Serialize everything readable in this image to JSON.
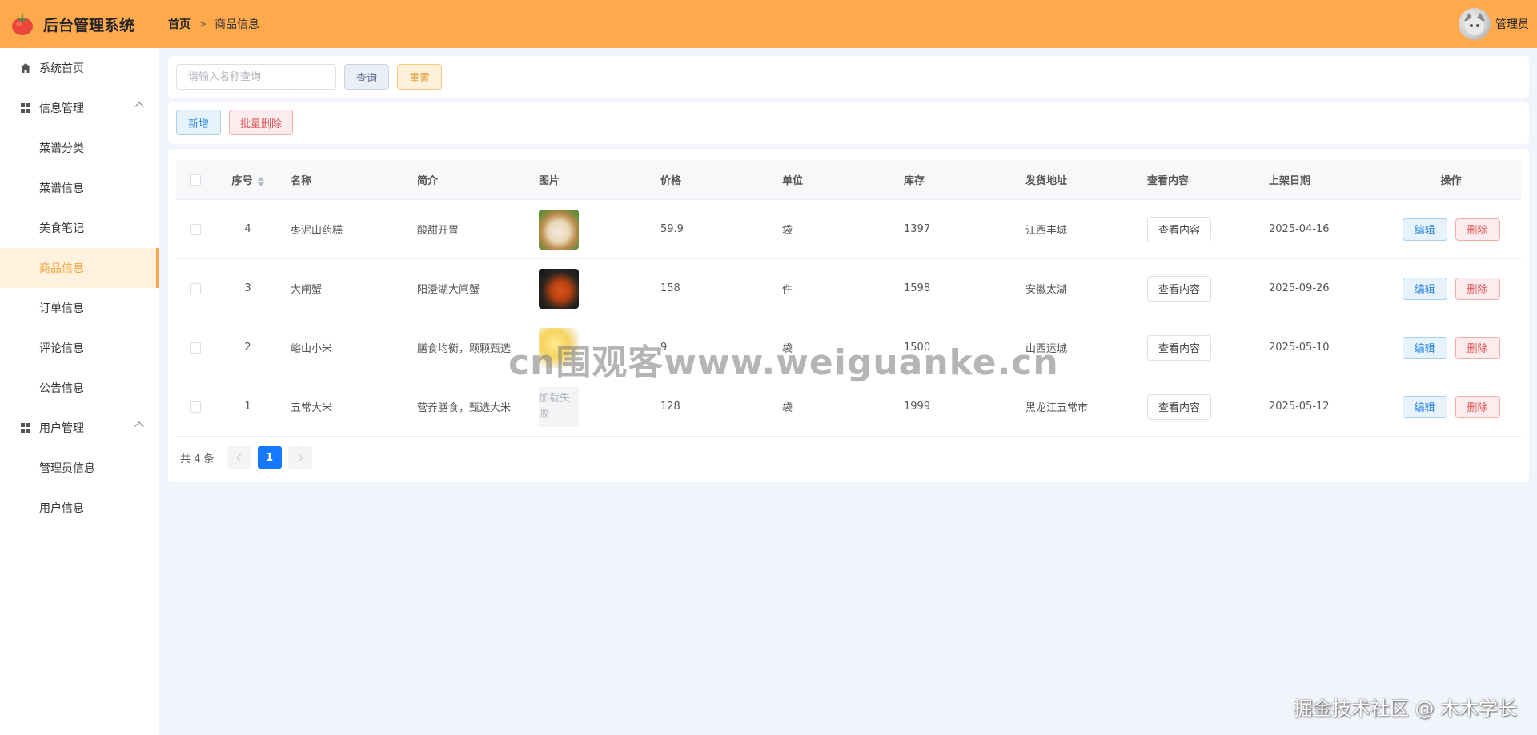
{
  "header": {
    "app_title": "后台管理系统",
    "breadcrumb_home": "首页",
    "breadcrumb_current": "商品信息",
    "user_name": "管理员",
    "bg_color": "#ffa94d"
  },
  "sidebar": {
    "items": [
      {
        "label": "系统首页",
        "icon": "home-icon",
        "type": "top"
      },
      {
        "label": "信息管理",
        "icon": "grid-icon",
        "type": "group"
      },
      {
        "label": "菜谱分类",
        "type": "sub"
      },
      {
        "label": "菜谱信息",
        "type": "sub"
      },
      {
        "label": "美食笔记",
        "type": "sub"
      },
      {
        "label": "商品信息",
        "type": "sub",
        "active": true
      },
      {
        "label": "订单信息",
        "type": "sub"
      },
      {
        "label": "评论信息",
        "type": "sub"
      },
      {
        "label": "公告信息",
        "type": "sub"
      },
      {
        "label": "用户管理",
        "icon": "grid-icon",
        "type": "group"
      },
      {
        "label": "管理员信息",
        "type": "sub"
      },
      {
        "label": "用户信息",
        "type": "sub"
      }
    ]
  },
  "search": {
    "placeholder": "请输入名称查询",
    "query_label": "查询",
    "reset_label": "重置"
  },
  "ops": {
    "add_label": "新增",
    "batch_delete_label": "批量删除"
  },
  "table": {
    "columns": [
      "序号",
      "名称",
      "简介",
      "图片",
      "价格",
      "单位",
      "库存",
      "发货地址",
      "查看内容",
      "上架日期",
      "操作"
    ],
    "rows": [
      {
        "no": "4",
        "name": "枣泥山药糕",
        "intro": "酸甜开胃",
        "image": "thumb-1",
        "price": "59.9",
        "unit": "袋",
        "stock": "1397",
        "addr": "江西丰城",
        "view": "查看内容",
        "date": "2025-04-16",
        "edit": "编辑",
        "del": "删除"
      },
      {
        "no": "3",
        "name": "大闸蟹",
        "intro": "阳澄湖大闸蟹",
        "image": "thumb-2",
        "price": "158",
        "unit": "件",
        "stock": "1598",
        "addr": "安徽太湖",
        "view": "查看内容",
        "date": "2025-09-26",
        "edit": "编辑",
        "del": "删除"
      },
      {
        "no": "2",
        "name": "峪山小米",
        "intro": "膳食均衡，颗颗甄选",
        "image": "thumb-3",
        "price": "9",
        "unit": "袋",
        "stock": "1500",
        "addr": "山西运城",
        "view": "查看内容",
        "date": "2025-05-10",
        "edit": "编辑",
        "del": "删除"
      },
      {
        "no": "1",
        "name": "五常大米",
        "intro": "营养膳食，甄选大米",
        "image": "fail",
        "image_fail_text": "加载失败",
        "price": "128",
        "unit": "袋",
        "stock": "1999",
        "addr": "黑龙江五常市",
        "view": "查看内容",
        "date": "2025-05-12",
        "edit": "编辑",
        "del": "删除"
      }
    ]
  },
  "pagination": {
    "total_text": "共 4 条",
    "current_page": "1"
  },
  "watermarks": {
    "center": "cn围观客www.weiguanke.cn",
    "corner": "掘金技术社区 @ 木木学长"
  }
}
